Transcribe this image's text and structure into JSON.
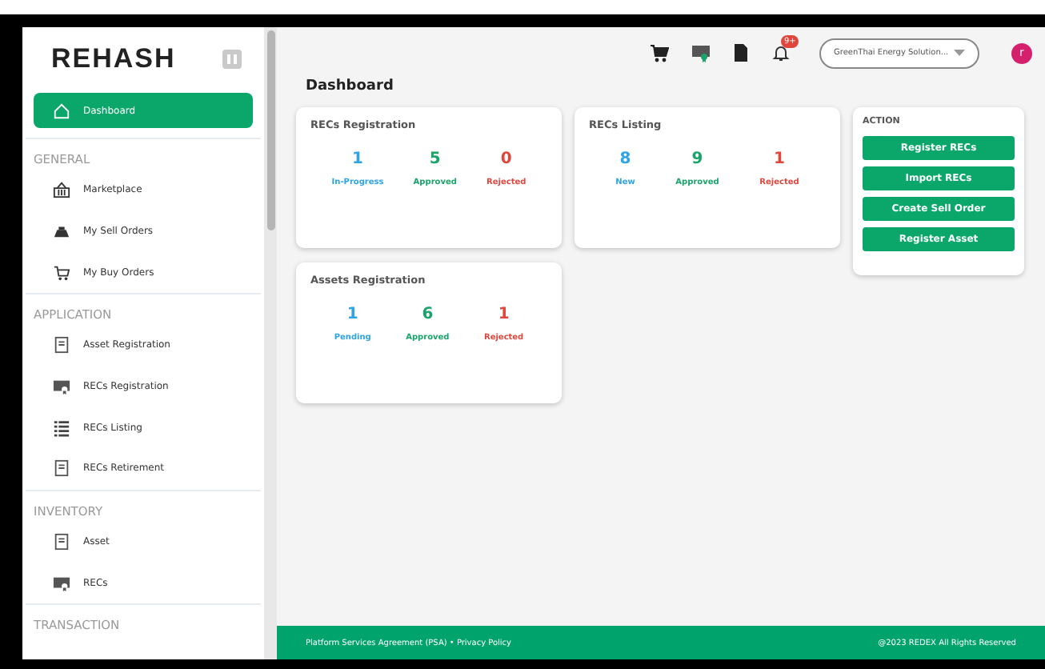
{
  "sidebar": {
    "logo": "REHASH",
    "items": [
      {
        "kind": "item",
        "label": "Dashboard",
        "selected": true
      },
      {
        "kind": "section",
        "label": "GENERAL"
      },
      {
        "kind": "item",
        "label": "Marketplace",
        "selected": false
      },
      {
        "kind": "item",
        "label": "My Sell Orders",
        "selected": false
      },
      {
        "kind": "item",
        "label": "My Buy Orders",
        "selected": false
      },
      {
        "kind": "section",
        "label": "APPLICATION"
      },
      {
        "kind": "item",
        "label": "Asset Registration",
        "selected": false
      },
      {
        "kind": "item",
        "label": "RECs Registration",
        "selected": false
      },
      {
        "kind": "item",
        "label": "RECs Listing",
        "selected": false
      },
      {
        "kind": "item",
        "label": "RECs Retirement",
        "selected": false
      },
      {
        "kind": "section",
        "label": "INVENTORY"
      },
      {
        "kind": "item",
        "label": "Asset",
        "selected": false
      },
      {
        "kind": "item",
        "label": "RECs",
        "selected": false
      },
      {
        "kind": "section",
        "label": "TRANSACTION"
      }
    ]
  },
  "header": {
    "notification_badge": "9+",
    "organization": "GreenThai Energy Solution...",
    "avatar": "r"
  },
  "page_title": "Dashboard",
  "cards": [
    {
      "title": "RECs Registration",
      "stats": [
        {
          "value": "1",
          "label": "In-Progress",
          "color": "#2ea3e6"
        },
        {
          "value": "5",
          "label": "Approved",
          "color": "#1aa36a"
        },
        {
          "value": "0",
          "label": "Rejected",
          "color": "#e0463c"
        }
      ]
    },
    {
      "title": "RECs Listing",
      "stats": [
        {
          "value": "8",
          "label": "New",
          "color": "#2ea3e6"
        },
        {
          "value": "9",
          "label": "Approved",
          "color": "#1aa36a"
        },
        {
          "value": "1",
          "label": "Rejected",
          "color": "#e0463c"
        }
      ]
    },
    {
      "title": "Assets Registration",
      "stats": [
        {
          "value": "1",
          "label": "Pending",
          "color": "#2ea3e6"
        },
        {
          "value": "6",
          "label": "Approved",
          "color": "#1aa36a"
        },
        {
          "value": "1",
          "label": "Rejected",
          "color": "#e0463c"
        }
      ]
    }
  ],
  "action": {
    "title": "ACTION",
    "buttons": [
      "Register RECs",
      "Import RECs",
      "Create Sell Order",
      "Register Asset"
    ]
  },
  "footer": {
    "links": "Platform Services Agreement (PSA) • Privacy Policy",
    "copyright": "@2023 REDEX All Rights Reserved"
  }
}
